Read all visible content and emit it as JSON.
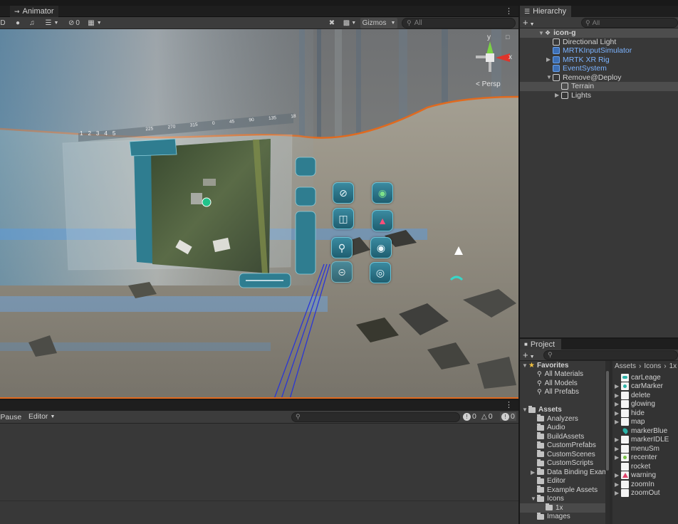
{
  "scene": {
    "tab_label": "Animator",
    "toolbar": {
      "hidden_count": "0",
      "gizmos_label": "Gizmos",
      "search_placeholder": "All"
    },
    "orientation": {
      "y_label": "y",
      "x_label": "x",
      "persp_label": "< Persp"
    },
    "hud": {
      "compass_pages": [
        "1",
        "2",
        "3",
        "4",
        "5"
      ],
      "compass_ticks": [
        "225",
        "270",
        "315",
        "0",
        "45",
        "90",
        "135",
        "18"
      ]
    }
  },
  "console": {
    "pause_label": "r Pause",
    "editor_label": "Editor",
    "counts": {
      "log": "0",
      "warn": "0",
      "error": "0"
    }
  },
  "hierarchy": {
    "tab_label": "Hierarchy",
    "search_placeholder": "All",
    "rows": [
      {
        "label": "icon-g",
        "bold": true
      },
      {
        "label": "Directional Light",
        "blue": false
      },
      {
        "label": "MRTKInputSimulator",
        "blue": true
      },
      {
        "label": "MRTK XR Rig",
        "blue": true
      },
      {
        "label": "EventSystem",
        "blue": true
      },
      {
        "label": "Remove@Deploy",
        "blue": false
      },
      {
        "label": "Terrain",
        "blue": false
      },
      {
        "label": "Lights",
        "blue": false
      }
    ]
  },
  "project": {
    "tab_label": "Project",
    "breadcrumb": [
      "Assets",
      "Icons",
      "1x"
    ],
    "favorites": {
      "label": "Favorites",
      "items": [
        "All Materials",
        "All Models",
        "All Prefabs"
      ]
    },
    "assets": {
      "label": "Assets",
      "folders": [
        "Analyzers",
        "Audio",
        "BuildAssets",
        "CustomPrefabs",
        "CustomScenes",
        "CustomScripts",
        "Data Binding Exam",
        "Editor",
        "Example Assets",
        "Icons",
        "1x",
        "Images"
      ]
    },
    "files": [
      "carLeage",
      "carMarker",
      "delete",
      "glowing",
      "hide",
      "map",
      "markerBlue",
      "markerIDLE",
      "menuSm",
      "recenter",
      "rocket",
      "warning",
      "zoomIn",
      "zoomOut"
    ]
  },
  "colors": {
    "accent_orange": "#e06a1f",
    "hud_teal": "#2f7d90",
    "link_blue": "#7cb3ff"
  }
}
